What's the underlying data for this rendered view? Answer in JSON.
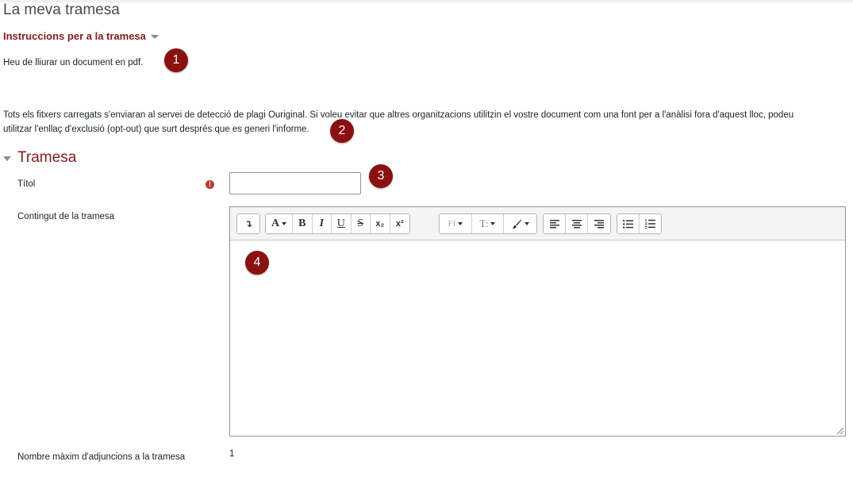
{
  "page": {
    "title": "La meva tramesa"
  },
  "instructions": {
    "heading": "Instruccions per a la tramesa",
    "text": "Heu de lliurar un document en pdf.",
    "plagiarism_line1": "Tots els fitxers carregats s'enviaran al servei de detecció de plagi Ouriginal. Si voleu evitar que altres organitzacions utilitzin el vostre document com una font per a l'anàlisi fora d'aquest lloc, podeu",
    "plagiarism_line2": "utilitzar l'enllaç d'exclusió (opt-out) que surt després que es generi l'informe."
  },
  "section": {
    "heading": "Tramesa"
  },
  "form": {
    "title_label": "Títol",
    "title_value": "",
    "required_icon": "exclamation-circle-icon",
    "content_label": "Contingut de la tramesa",
    "content_value": "",
    "max_attachments_label": "Nombre màxim d'adjuncions a la tramesa",
    "max_attachments_value": "1"
  },
  "toolbar": {
    "toggle": "↴",
    "font_color": "A",
    "bold": "B",
    "italic": "I",
    "underline": "U",
    "strike": "S",
    "subscript": "x₂",
    "superscript": "x²",
    "font_family": "Ff",
    "font_size": "T:",
    "brush_icon": "paintbrush-icon",
    "align_left_icon": "align-left-icon",
    "align_center_icon": "align-center-icon",
    "align_right_icon": "align-right-icon",
    "unordered_list_icon": "unordered-list-icon",
    "ordered_list_icon": "ordered-list-icon"
  },
  "callouts": [
    "1",
    "2",
    "3",
    "4"
  ],
  "colors": {
    "accent": "#8b1a1a",
    "badge": "#8b1010",
    "required": "#c0392b"
  }
}
